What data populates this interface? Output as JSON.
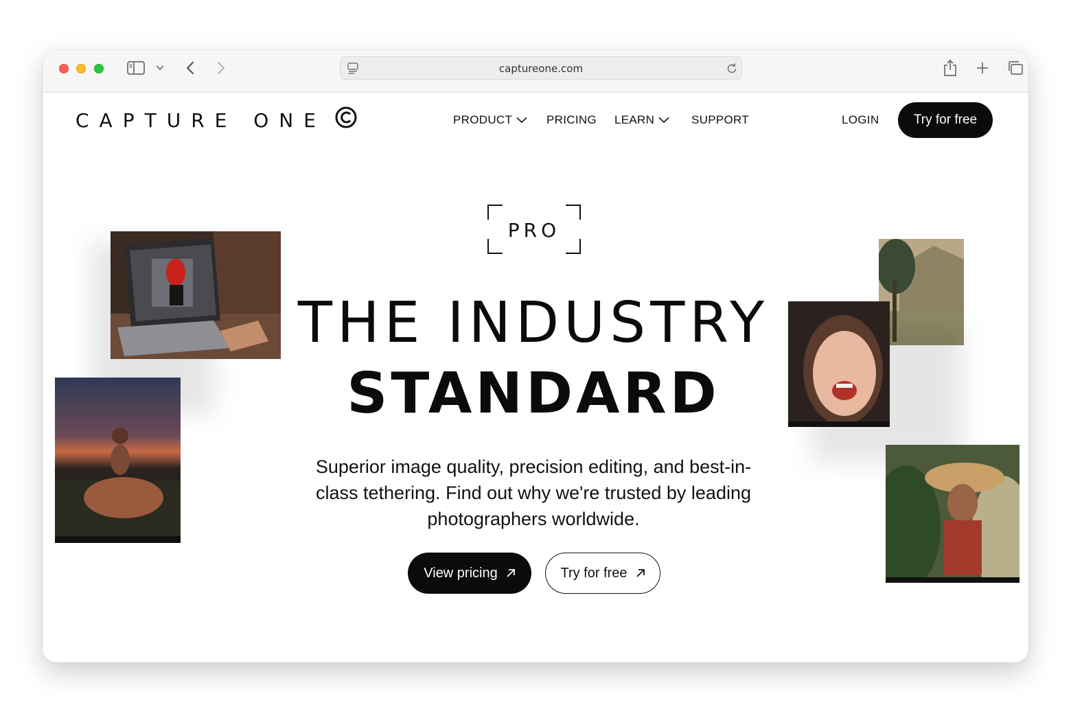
{
  "browser": {
    "url": "captureone.com",
    "icons": [
      "sidebar-icon",
      "chevron-down-icon",
      "back-icon",
      "forward-icon",
      "site-settings-icon",
      "reload-icon",
      "share-icon",
      "new-tab-icon",
      "tabs-overview-icon"
    ]
  },
  "nav": {
    "logo_text": "CAPTURE ONE",
    "links": [
      {
        "label": "PRODUCT",
        "dropdown": true
      },
      {
        "label": "PRICING",
        "dropdown": false
      },
      {
        "label": "LEARN",
        "dropdown": true
      },
      {
        "label": "SUPPORT",
        "dropdown": false
      }
    ],
    "login": "LOGIN",
    "cta": "Try for free"
  },
  "hero": {
    "badge": "PRO",
    "headline_line1": "THE INDUSTRY",
    "headline_line2": "STANDARD",
    "subtitle": "Superior image quality, precision editing, and best-in-class tethering. Find out why we're trusted by leading photographers worldwide.",
    "buttons": [
      {
        "label": "View pricing",
        "style": "dark",
        "icon": "arrow-up-right-icon"
      },
      {
        "label": "Try for free",
        "style": "outline",
        "icon": "arrow-up-right-icon"
      }
    ]
  },
  "colors": {
    "primary": "#0b0b0b",
    "background": "#ffffff",
    "traffic_red": "#ff5f57",
    "traffic_yellow": "#febc2e",
    "traffic_green": "#28c840"
  }
}
